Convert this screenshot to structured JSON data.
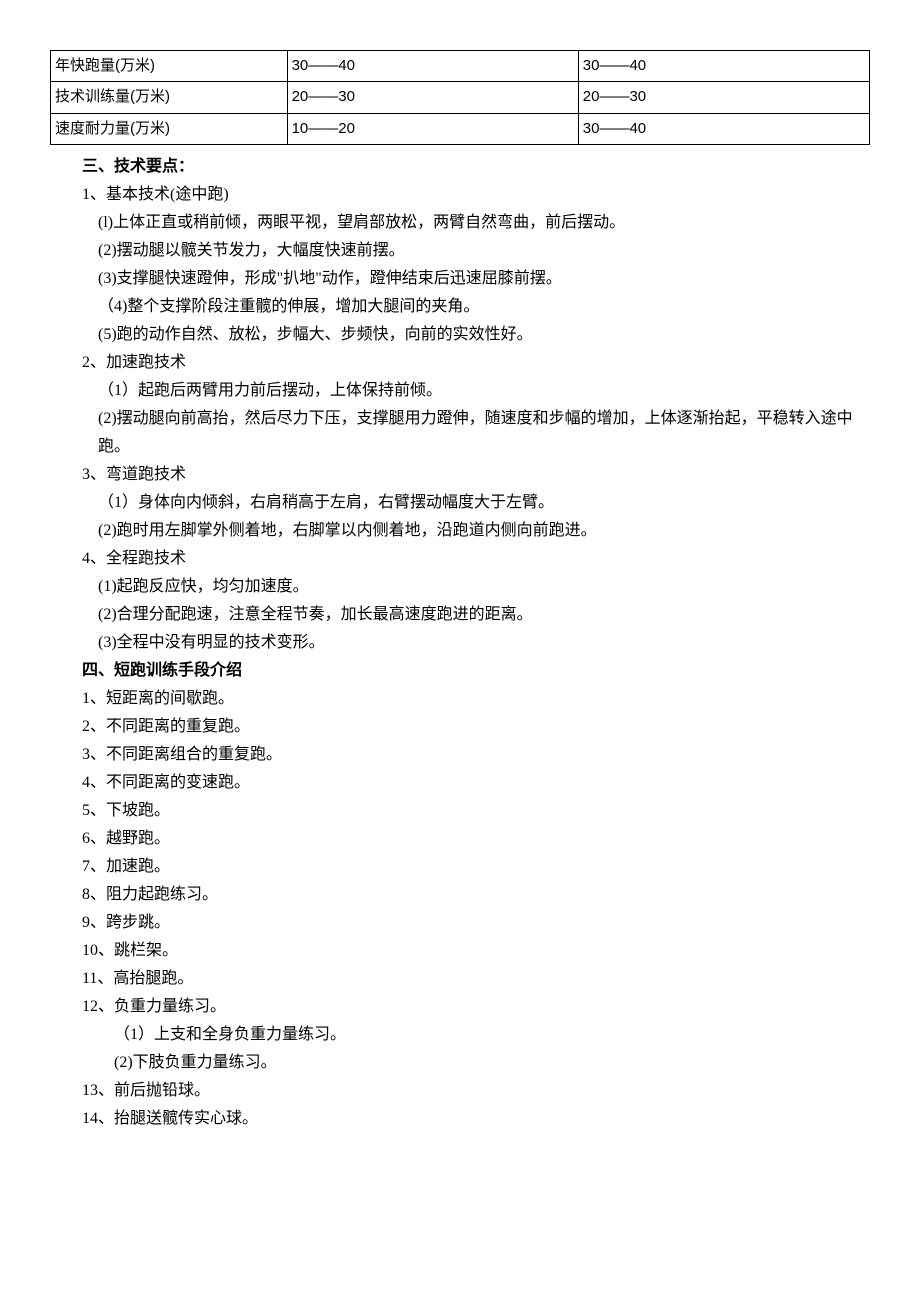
{
  "table": {
    "rows": [
      {
        "label": "年快跑量(万米)",
        "v1": "30——40",
        "v2": "30——40"
      },
      {
        "label": "技术训练量(万米)",
        "v1": "20——30",
        "v2": "20——30"
      },
      {
        "label": "速度耐力量(万米)",
        "v1": "10——20",
        "v2": "30——40"
      }
    ]
  },
  "sec3": {
    "heading": "三、技术要点：",
    "s1": {
      "title": "1、基本技术(途中跑)",
      "i1": "(l)上体正直或稍前倾，两眼平视，望肩部放松，两臂自然弯曲，前后摆动。",
      "i2": "(2)摆动腿以髋关节发力，大幅度快速前摆。",
      "i3": "(3)支撑腿快速蹬伸，形成\"扒地\"动作，蹬伸结束后迅速屈膝前摆。",
      "i4": "（4)整个支撑阶段注重髋的伸展，增加大腿间的夹角。",
      "i5": "(5)跑的动作自然、放松，步幅大、步频快，向前的实效性好。"
    },
    "s2": {
      "title": "2、加速跑技术",
      "i1": "（1）起跑后两臂用力前后摆动，上体保持前倾。",
      "i2": "(2)摆动腿向前高抬，然后尽力下压，支撑腿用力蹬伸，随速度和步幅的增加，上体逐渐抬起，平稳转入途中跑。"
    },
    "s3": {
      "title": "3、弯道跑技术",
      "i1": "（1）身体向内倾斜，右肩稍高于左肩，右臂摆动幅度大于左臂。",
      "i2": "(2)跑时用左脚掌外侧着地，右脚掌以内侧着地，沿跑道内侧向前跑进。"
    },
    "s4": {
      "title": "4、全程跑技术",
      "i1": "(1)起跑反应快，均匀加速度。",
      "i2": "(2)合理分配跑速，注意全程节奏，加长最高速度跑进的距离。",
      "i3": "(3)全程中没有明显的技术变形。"
    }
  },
  "sec4": {
    "heading": "四、短跑训练手段介绍",
    "i1": "1、短距离的间歇跑。",
    "i2": "2、不同距离的重复跑。",
    "i3": "3、不同距离组合的重复跑。",
    "i4": "4、不同距离的变速跑。",
    "i5": "5、下坡跑。",
    "i6": "6、越野跑。",
    "i7": "7、加速跑。",
    "i8": "8、阻力起跑练习。",
    "i9": "9、跨步跳。",
    "i10": "10、跳栏架。",
    "i11": "11、高抬腿跑。",
    "i12": "12、负重力量练习。",
    "i12a": "（1）上支和全身负重力量练习。",
    "i12b": "(2)下肢负重力量练习。",
    "i13": "13、前后抛铅球。",
    "i14": "14、抬腿送髋传实心球。"
  }
}
